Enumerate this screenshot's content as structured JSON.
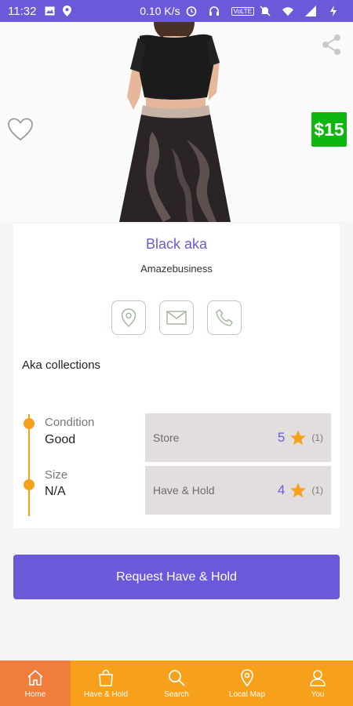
{
  "status_bar": {
    "time": "11:32",
    "network_speed": "0.10 K/s",
    "volte": "VoLTE",
    "icons": [
      "gallery-icon",
      "location-icon",
      "alarm-icon",
      "headset-icon",
      "mute-icon",
      "wifi-icon",
      "signal-icon",
      "battery-charging-icon"
    ]
  },
  "product": {
    "price": "$15",
    "title": "Black aka",
    "seller": "Amazebusiness",
    "description": "Aka collections",
    "attributes": [
      {
        "label": "Condition",
        "value": "Good"
      },
      {
        "label": "Size",
        "value": "N/A"
      }
    ],
    "ratings": [
      {
        "label": "Store",
        "value": "5",
        "count": "(1)"
      },
      {
        "label": "Have & Hold",
        "value": "4",
        "count": "(1)"
      }
    ]
  },
  "actions": {
    "request_label": "Request Have & Hold"
  },
  "bottom_nav": {
    "items": [
      {
        "label": "Home",
        "icon": "home-icon",
        "active": true
      },
      {
        "label": "Have & Hold",
        "icon": "bag-icon",
        "active": false
      },
      {
        "label": "Search",
        "icon": "search-icon",
        "active": false
      },
      {
        "label": "Local Map",
        "icon": "map-pin-icon",
        "active": false
      },
      {
        "label": "You",
        "icon": "user-icon",
        "active": false
      }
    ]
  },
  "colors": {
    "primary": "#6a5ad9",
    "accent": "#f7a01b",
    "active_nav": "#ef7e3c",
    "price_badge": "#0fb510"
  }
}
